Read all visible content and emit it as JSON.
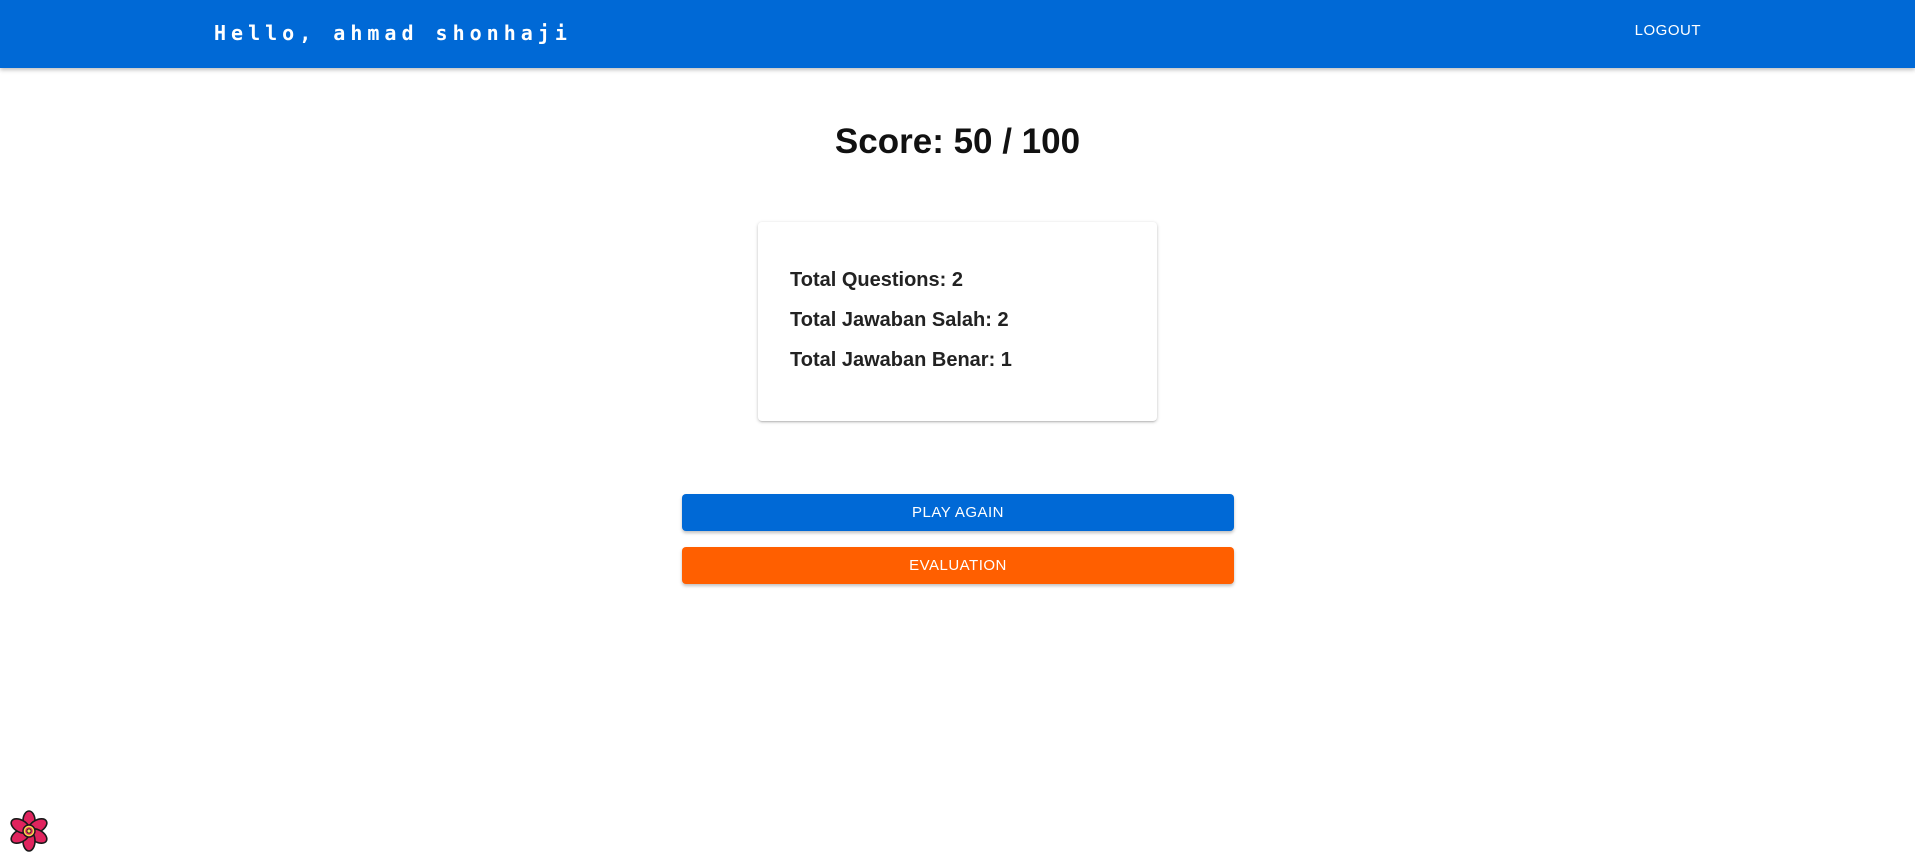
{
  "header": {
    "greeting": "Hello, ahmad shonhaji",
    "logout_label": "LOGOUT"
  },
  "result": {
    "score_text": "Score: 50 / 100",
    "stats": [
      {
        "label": "Total Questions: 2"
      },
      {
        "label": "Total Jawaban Salah: 2"
      },
      {
        "label": "Total Jawaban Benar: 1"
      }
    ]
  },
  "actions": {
    "play_again_label": "PLAY AGAIN",
    "evaluation_label": "EVALUATION"
  },
  "colors": {
    "primary": "#0069d6",
    "accent": "#ff5f00"
  },
  "icons": {
    "corner_icon": "flower-icon"
  }
}
